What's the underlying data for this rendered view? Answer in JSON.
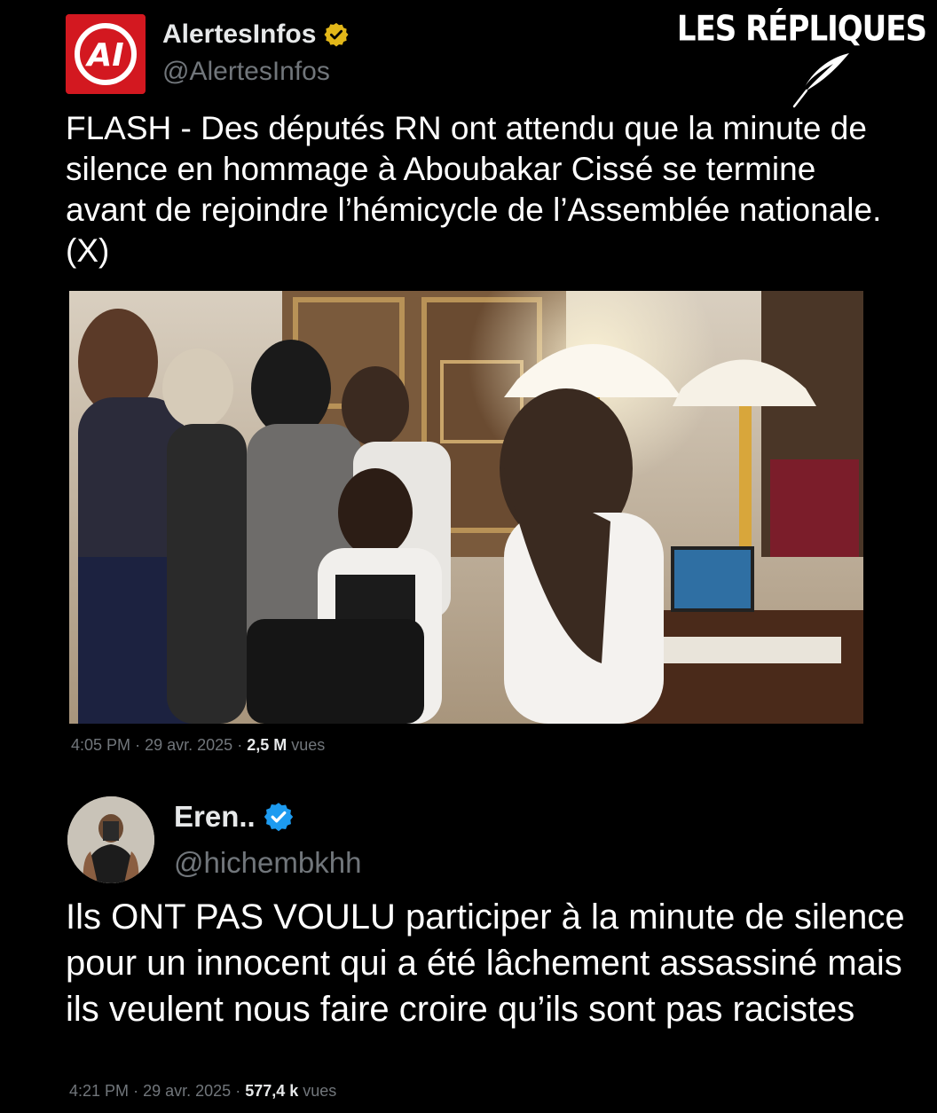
{
  "watermark": {
    "text": "LES RÉPLIQUES",
    "icon": "quill-icon"
  },
  "tweets": [
    {
      "avatar": {
        "text": "AI",
        "icon": "alertesinfos-logo",
        "color": "#d31820"
      },
      "display_name": "AlertesInfos",
      "badge": "gold-verified-badge-icon",
      "handle": "@AlertesInfos",
      "text": "FLASH - Des députés RN ont attendu que la minute de silence en hommage à Aboubakar Cissé se termine avant de rejoindre l’hémicycle de l’Assemblée nationale. (X)",
      "time": "4:05 PM",
      "date": "29 avr. 2025",
      "views_count": "2,5 M",
      "views_label": "vues"
    },
    {
      "avatar": {
        "icon": "user-avatar-photo"
      },
      "display_name": "Eren..",
      "badge": "blue-verified-badge-icon",
      "handle": "@hichembkhh",
      "text": "Ils ONT PAS VOULU participer à la minute de silence pour un innocent qui a été lâchement assassiné mais ils veulent nous faire croire qu’ils sont pas racistes",
      "time": "4:21 PM",
      "date": "29 avr. 2025",
      "views_count": "577,4 k",
      "views_label": "vues"
    }
  ]
}
